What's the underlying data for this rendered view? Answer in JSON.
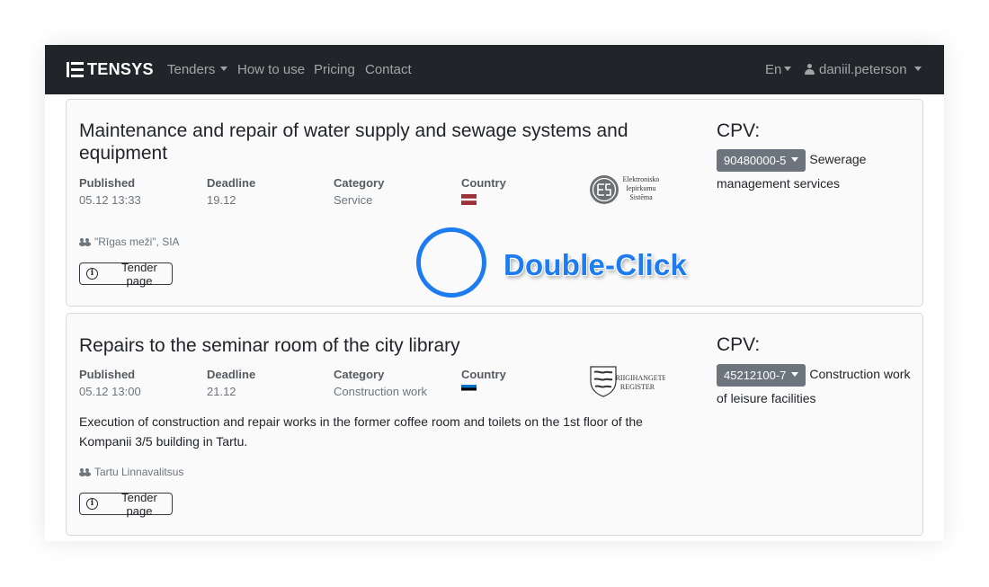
{
  "nav": {
    "brand": "TENSYS",
    "links": [
      "Tenders",
      "How to use",
      "Pricing",
      "Contact"
    ],
    "language": "En",
    "user": "daniil.peterson"
  },
  "labels": {
    "published": "Published",
    "deadline": "Deadline",
    "category": "Category",
    "country": "Country",
    "cpv": "CPV:",
    "tender_page": "Tender page"
  },
  "tenders": [
    {
      "title": "Maintenance and repair of water supply and sewage systems and equipment",
      "published": "05.12 13:33",
      "deadline": "19.12",
      "category": "Service",
      "country_flag": "latvia",
      "source_logo_text": [
        "Elektronisko",
        "Iepirkumu",
        "Sistēma"
      ],
      "agency": "\"Rīgas meži\", SIA",
      "description": "",
      "cpv_code": "90480000-5",
      "cpv_desc": "Sewerage management services"
    },
    {
      "title": "Repairs to the seminar room of the city library",
      "published": "05.12 13:00",
      "deadline": "21.12",
      "category": "Construction work",
      "country_flag": "estonia",
      "source_logo_text": [
        "RIIGIHANGETE",
        "REGISTER"
      ],
      "agency": "Tartu Linnavalitsus",
      "description": "Execution of construction and repair works in the former coffee room and toilets on the 1st floor of the Kompanii 3/5 building in Tartu.",
      "cpv_code": "45212100-7",
      "cpv_desc": "Construction work of leisure facilities"
    }
  ],
  "overlay": {
    "action": "Double-Click",
    "color": "#1e7cf0"
  }
}
